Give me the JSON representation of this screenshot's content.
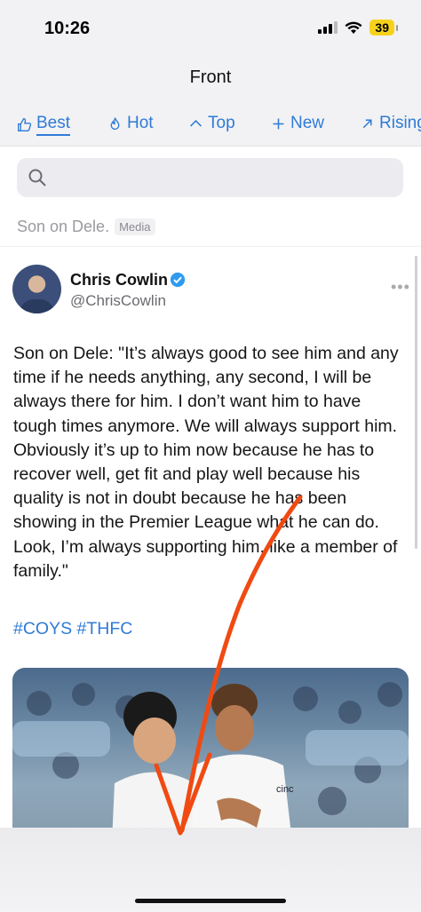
{
  "status_bar": {
    "time": "10:26",
    "battery": "39",
    "battery_color": "#f7d21c"
  },
  "nav": {
    "title": "Front"
  },
  "sort_tabs": [
    {
      "label": "Best",
      "icon": "thumbs-up-icon",
      "active": true
    },
    {
      "label": "Hot",
      "icon": "flame-icon",
      "active": false
    },
    {
      "label": "Top",
      "icon": "chevron-up-icon",
      "active": false
    },
    {
      "label": "New",
      "icon": "plus-icon",
      "active": false
    },
    {
      "label": "Rising",
      "icon": "arrow-up-right-icon",
      "active": false
    }
  ],
  "search": {
    "placeholder": ""
  },
  "post": {
    "title": "Son on Dele.",
    "flair": "Media",
    "author_name": "Chris Cowlin",
    "author_handle": "@ChrisCowlin",
    "body": "Son on Dele: \"It’s always good to see him and any time if he needs anything, any second, I will be always there for him. I don’t want him to have tough times anymore. We will always support him. Obviously it’s up to him now because he has to recover well, get fit and play well because his quality is not in doubt because he has been showing in the Premier League what he can do. Look, I’m always supporting him, like a member of family.\"",
    "hashtags": "#COYS #THFC"
  },
  "colors": {
    "accent": "#2f7bd7",
    "annotation_arrow": "#f04a12",
    "background": "#f2f2f4"
  }
}
